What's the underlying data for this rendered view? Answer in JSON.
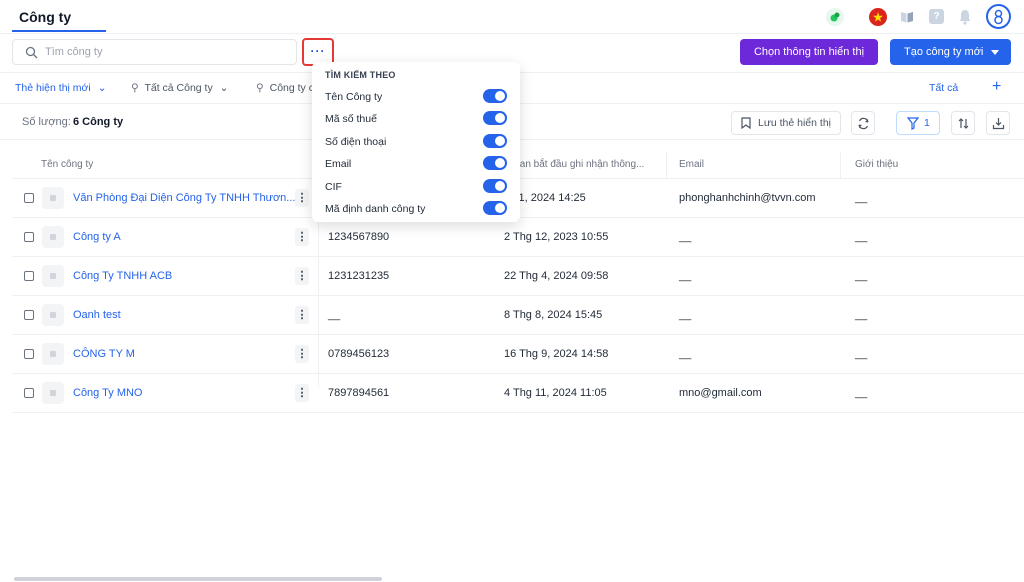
{
  "header": {
    "title": "Công ty"
  },
  "search": {
    "placeholder": "Tìm công ty",
    "more_label": "···"
  },
  "actions": {
    "choose_display": "Chọn thông tin hiển thị",
    "create_company": "Tạo công ty mới"
  },
  "tabs": {
    "items": [
      {
        "label": "Thẻ hiện thị mới"
      },
      {
        "label": "Tất cả Công ty"
      },
      {
        "label": "Công ty c"
      }
    ],
    "all_label": "Tất cả",
    "add_label": "+"
  },
  "count": {
    "label": "Số lượng:",
    "value": "6 Công ty"
  },
  "toolbar": {
    "save_view": "Lưu thẻ hiển thị",
    "filter_count": "1"
  },
  "table": {
    "headers": [
      "Tên công ty",
      "i gian bắt đầu ghi nhận thông...",
      "Email",
      "Giới thiệu"
    ],
    "rows": [
      {
        "name": "Văn Phòng Đại Diện Công Ty TNHH Thươn...",
        "tax": "",
        "date": "g 11, 2024 14:25",
        "email": "phonghanhchinh@tvvn.com",
        "intro": "__"
      },
      {
        "name": "Công ty A",
        "tax": "1234567890",
        "date": "2 Thg 12, 2023 10:55",
        "email": "__",
        "intro": "__"
      },
      {
        "name": "Công Ty TNHH ACB",
        "tax": "1231231235",
        "date": "22 Thg 4, 2024 09:58",
        "email": "__",
        "intro": "__"
      },
      {
        "name": "Oanh test",
        "tax": "__",
        "date": "8 Thg 8, 2024 15:45",
        "email": "__",
        "intro": "__"
      },
      {
        "name": "CÔNG TY M",
        "tax": "0789456123",
        "date": "16 Thg 9, 2024 14:58",
        "email": "__",
        "intro": "__"
      },
      {
        "name": "Công Ty MNO",
        "tax": "7897894561",
        "date": "4 Thg 11, 2024 11:05",
        "email": "mno@gmail.com",
        "intro": "__"
      }
    ]
  },
  "dropdown": {
    "heading": "TÌM KIẾM THEO",
    "items": [
      {
        "label": "Tên Công ty",
        "enabled": true
      },
      {
        "label": "Mã số thuế",
        "enabled": true
      },
      {
        "label": "Số điện thoại",
        "enabled": true
      },
      {
        "label": "Email",
        "enabled": true
      },
      {
        "label": "CIF",
        "enabled": true
      },
      {
        "label": "Mã định danh công ty",
        "enabled": true
      }
    ]
  },
  "colors": {
    "primary": "#2563eb",
    "purple": "#6d28d9",
    "highlight": "#e53935"
  },
  "icons": [
    "search-icon",
    "refresh-icon",
    "filter-icon",
    "sort-icon",
    "download-icon",
    "bookmark-icon",
    "bell-icon",
    "help-icon",
    "book-icon",
    "flag-vn-icon",
    "app-logo-icon",
    "user-avatar-icon"
  ]
}
